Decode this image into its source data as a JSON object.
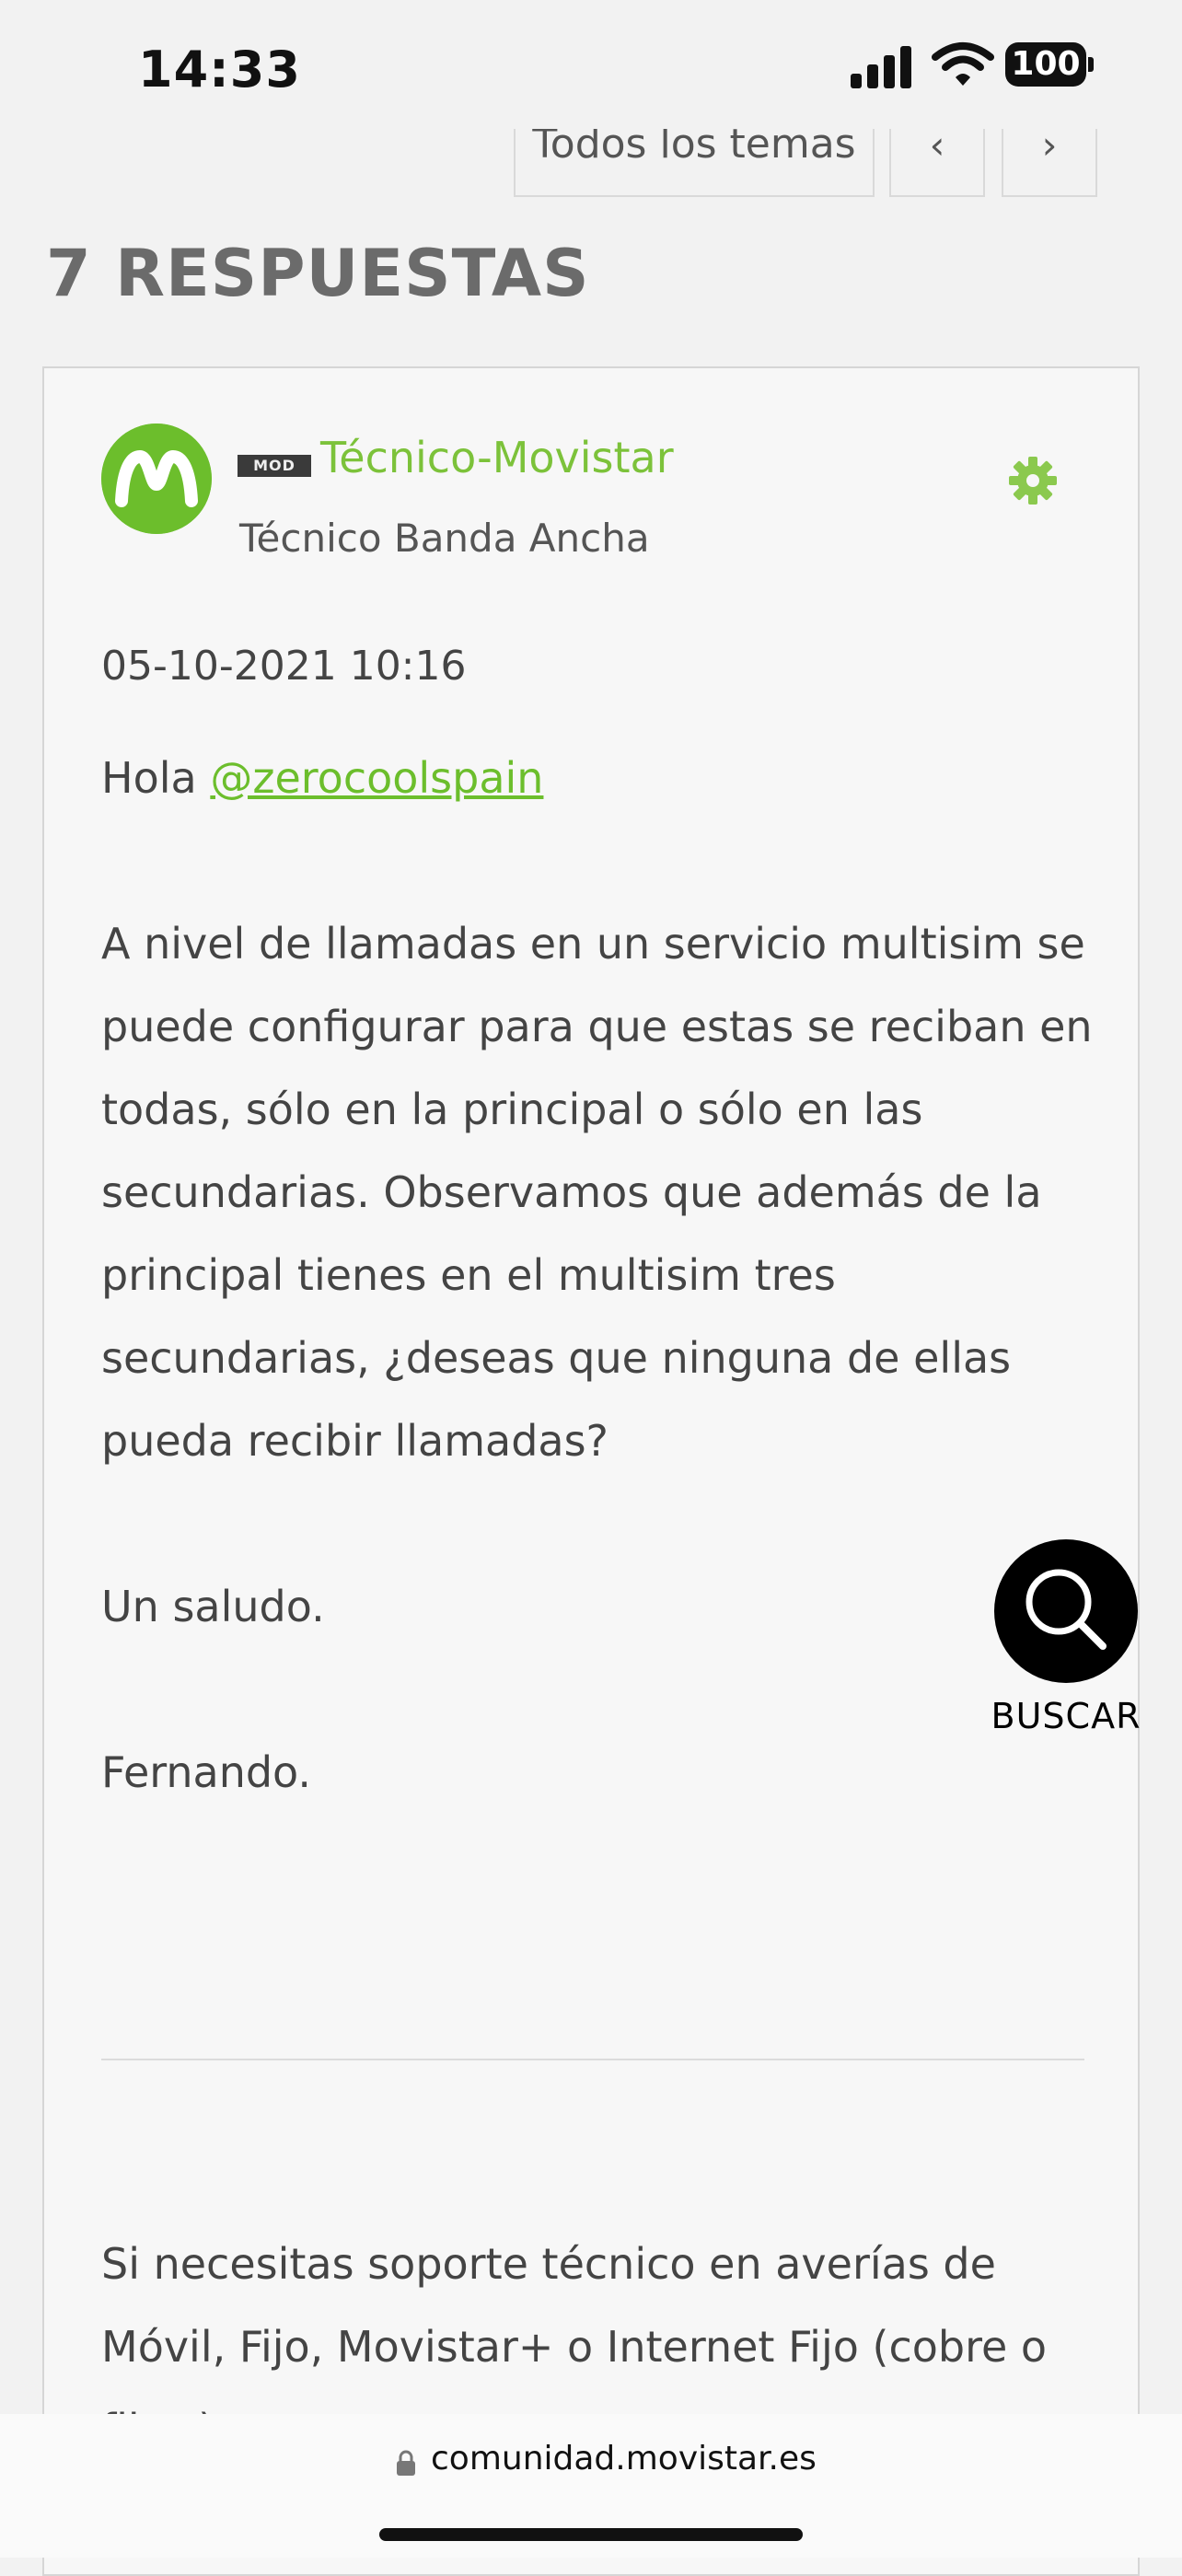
{
  "status_bar": {
    "time": "14:33",
    "battery": "100"
  },
  "topic_nav": {
    "all_topics": "Todos los temas",
    "prev": "‹",
    "next": "›"
  },
  "replies": {
    "heading": "7 RESPUESTAS"
  },
  "post": {
    "badge": "MOD",
    "author": "Técnico-Movistar",
    "rank": "Técnico Banda Ancha",
    "date": "05-10-2021 10:16",
    "greeting": "Hola ",
    "mention": "@zerocoolspain",
    "paragraph": "A nivel de llamadas en un servicio multisim se puede configurar para que estas se reciban en todas, sólo en la principal o sólo en las secundarias. Observamos que además de la principal tienes en el multisim tres secundarias, ¿deseas que ninguna de ellas pueda recibir llamadas?",
    "closing": "Un saludo.",
    "signoff": "Fernando.",
    "signature": "Si necesitas soporte técnico en averías de Móvil, Fijo, Movistar+ o Internet Fijo (cobre o fibra),"
  },
  "search_fab": {
    "label": "BUSCAR"
  },
  "browser": {
    "url": "comunidad.movistar.es"
  },
  "colors": {
    "accent": "#6cbe2c",
    "heading": "#6b6b6b"
  }
}
